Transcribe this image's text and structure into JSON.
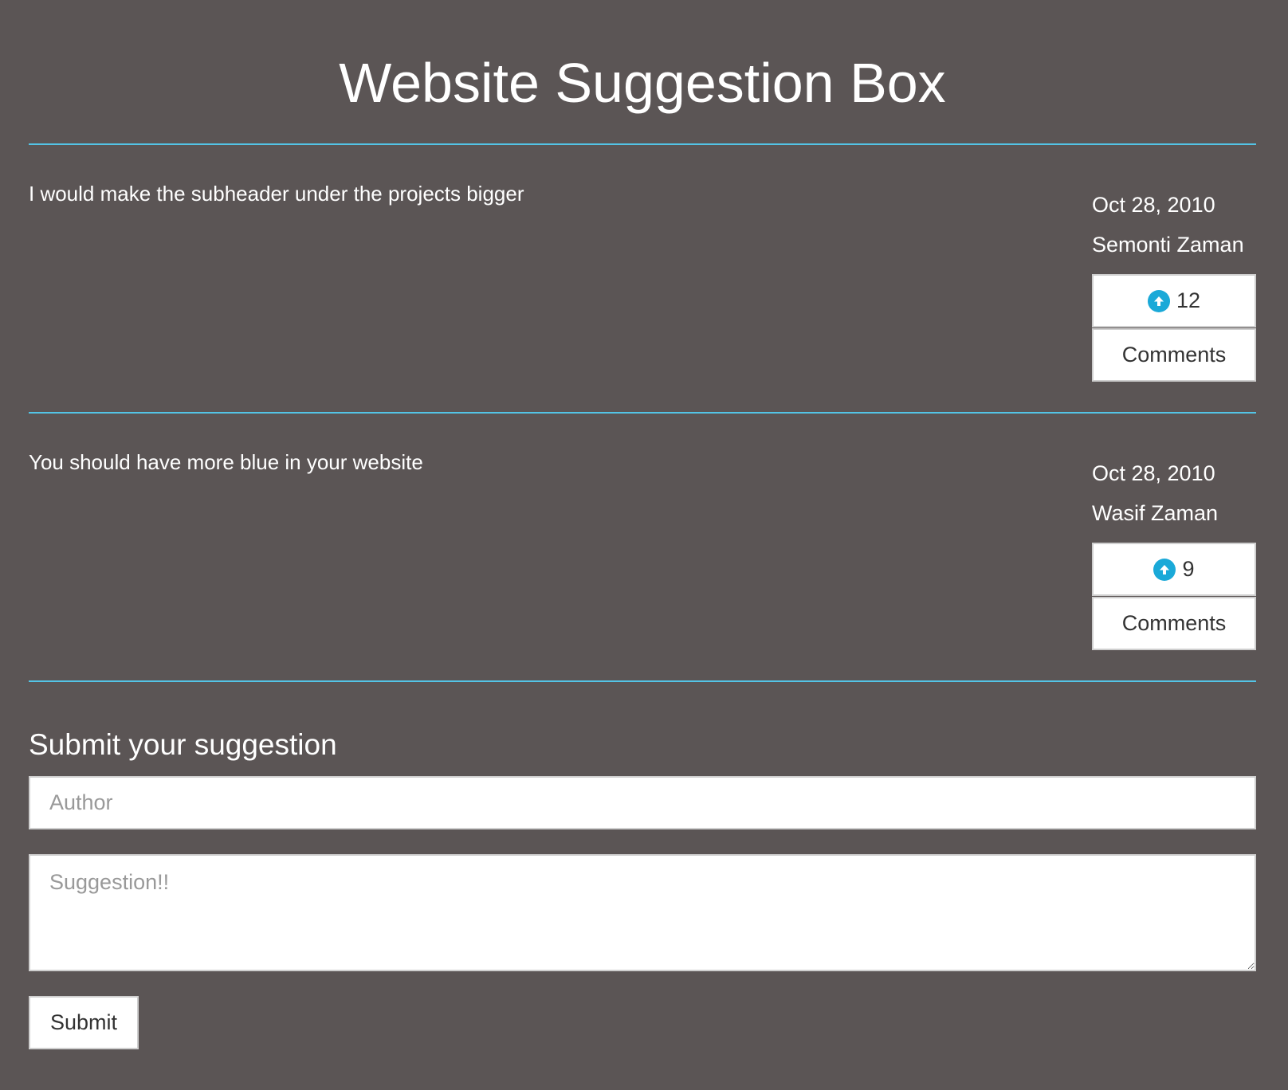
{
  "page": {
    "title": "Website Suggestion Box"
  },
  "suggestions": [
    {
      "text": "I would make the subheader under the projects bigger",
      "date": "Oct 28, 2010",
      "author": "Semonti Zaman",
      "votes": "12",
      "comments_label": "Comments"
    },
    {
      "text": "You should have more blue in your website",
      "date": "Oct 28, 2010",
      "author": "Wasif Zaman",
      "votes": "9",
      "comments_label": "Comments"
    }
  ],
  "form": {
    "heading": "Submit your suggestion",
    "author_placeholder": "Author",
    "author_value": "",
    "suggestion_placeholder": "Suggestion!!",
    "suggestion_value": "",
    "submit_label": "Submit"
  },
  "icons": {
    "vote": "arrow-up-circle-icon"
  },
  "colors": {
    "background": "#5b5555",
    "divider": "#53c4e6",
    "vote_icon": "#1aa9d8",
    "text": "#ffffff",
    "button_text": "#333333"
  }
}
